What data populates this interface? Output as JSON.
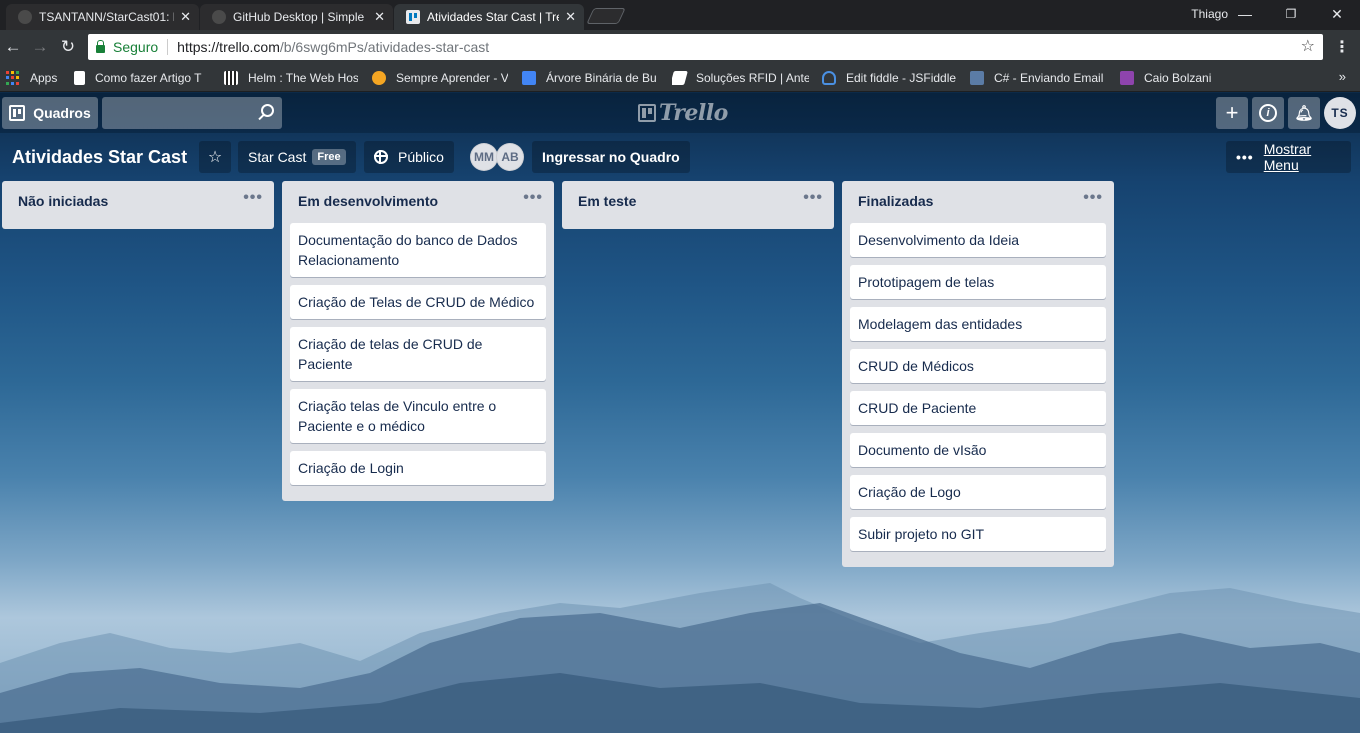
{
  "browser": {
    "tabs": [
      {
        "title": "TSANTANN/StarCast01: P",
        "icon": "github-icon"
      },
      {
        "title": "GitHub Desktop | Simple",
        "icon": "github-icon"
      },
      {
        "title": "Atividades Star Cast | Trel",
        "icon": "trello-icon",
        "active": true
      }
    ],
    "user": "Thiago",
    "window_controls": {
      "minimize": "—",
      "maximize": "❐",
      "close": "✕"
    },
    "secure_label": "Seguro",
    "url_host": "https://trello.com",
    "url_path": "/b/6swg6mPs/atividades-star-cast",
    "bookmarks": [
      {
        "label": "Apps"
      },
      {
        "label": "Como fazer Artigo T"
      },
      {
        "label": "Helm : The Web Hos"
      },
      {
        "label": "Sempre Aprender - V"
      },
      {
        "label": "Árvore Binária de Bu"
      },
      {
        "label": "Soluções RFID | Ante"
      },
      {
        "label": "Edit fiddle - JSFiddle"
      },
      {
        "label": "C# - Enviando Email"
      },
      {
        "label": "Caio Bolzani"
      }
    ],
    "bookmarks_more": "»"
  },
  "trello": {
    "header": {
      "boards_button": "Quadros",
      "search_placeholder": "",
      "logo_text": "Trello",
      "user_initials": "TS"
    },
    "board": {
      "title": "Atividades Star Cast",
      "team": "Star Cast",
      "team_badge": "Free",
      "visibility": "Público",
      "members": [
        "MM",
        "AB"
      ],
      "join_button": "Ingressar no Quadro",
      "menu_dots": "•••",
      "show_menu": "Mostrar Menu"
    },
    "lists": [
      {
        "title": "Não iniciadas",
        "menu": "•••",
        "cards": []
      },
      {
        "title": "Em desenvolvimento",
        "menu": "•••",
        "cards": [
          "Documentação do banco de Dados Relacionamento",
          "Criação de Telas de CRUD de Médico",
          "Criação de telas de CRUD de Paciente",
          "Criação telas de Vinculo entre o Paciente e o médico",
          "Criação de Login"
        ]
      },
      {
        "title": "Em teste",
        "menu": "•••",
        "cards": []
      },
      {
        "title": "Finalizadas",
        "menu": "•••",
        "cards": [
          "Desenvolvimento da Ideia",
          "Prototipagem de telas",
          "Modelagem das entidades",
          "CRUD de Médicos",
          "CRUD de Paciente",
          "Documento de vIsão",
          "Criação de Logo",
          "Subir projeto no GIT"
        ]
      }
    ]
  }
}
